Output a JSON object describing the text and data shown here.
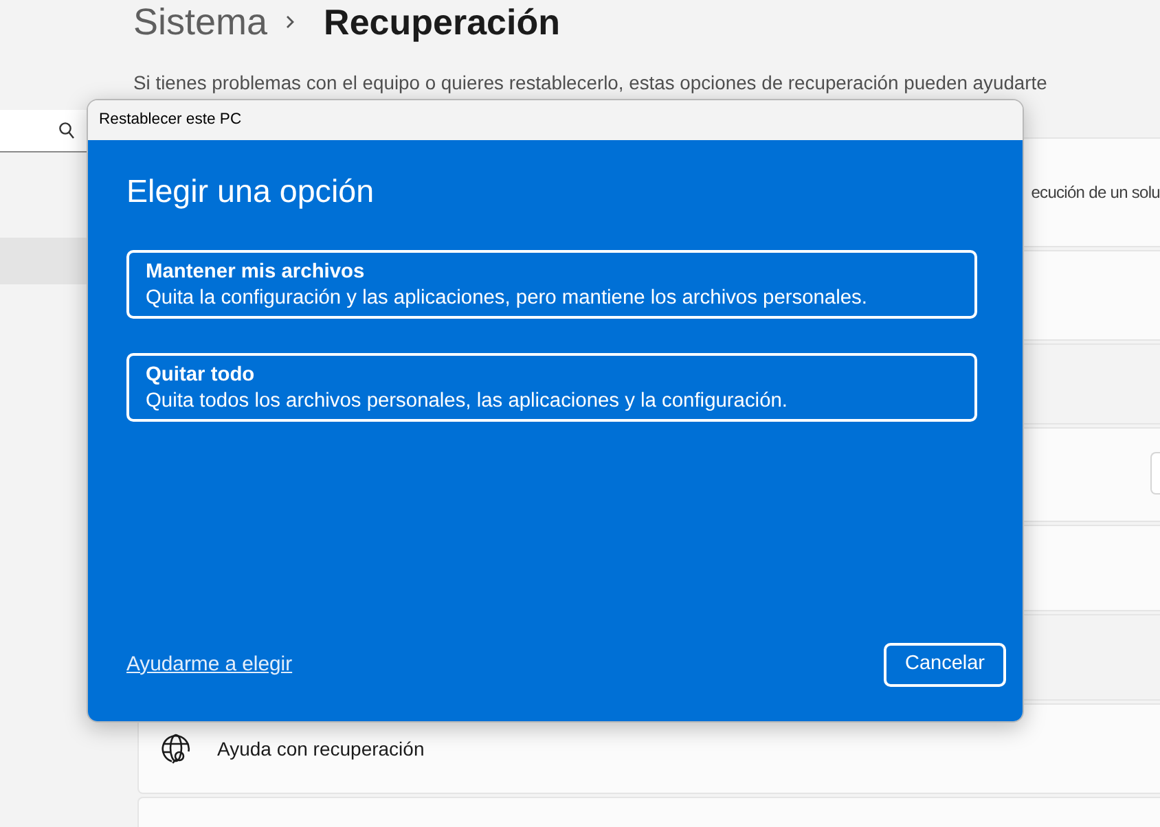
{
  "breadcrumb": {
    "parent": "Sistema",
    "current": "Recuperación"
  },
  "subtitle": "Si tienes problemas con el equipo o quieres restablecerlo, estas opciones de recuperación pueden ayudarte",
  "sidebar": {
    "items": [
      {
        "selected": true
      }
    ]
  },
  "settings_cards": [
    {
      "kind": "truncated_text",
      "text": "ecución de un solu"
    },
    {
      "kind": "blank"
    },
    {
      "kind": "band"
    },
    {
      "kind": "button"
    },
    {
      "kind": "blank"
    },
    {
      "kind": "band"
    },
    {
      "kind": "help",
      "label": "Ayuda con recuperación"
    },
    {
      "kind": "blank"
    }
  ],
  "dialog": {
    "title": "Restablecer este PC",
    "heading": "Elegir una opción",
    "options": [
      {
        "title": "Mantener mis archivos",
        "description": "Quita la configuración y las aplicaciones, pero mantiene los archivos personales."
      },
      {
        "title": "Quitar todo",
        "description": "Quita todos los archivos personales, las aplicaciones y la configuración."
      }
    ],
    "help_link": "Ayudarme a elegir",
    "cancel_button": "Cancelar"
  }
}
